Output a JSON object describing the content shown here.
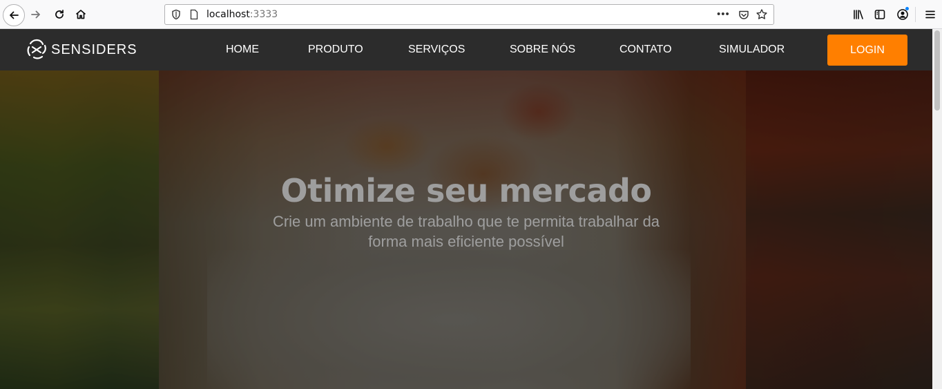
{
  "browser": {
    "url_host": "localhost",
    "url_port": ":3333",
    "more_label": "•••"
  },
  "site": {
    "logo_text": "SENSIDERS",
    "nav": [
      "HOME",
      "PRODUTO",
      "SERVIÇOS",
      "SOBRE NÓS",
      "CONTATO",
      "SIMULADOR"
    ],
    "login_label": "LOGIN",
    "accent_color": "#ff7f00",
    "navbar_color": "#2c2c2c"
  },
  "hero": {
    "title": "Otimize seu mercado",
    "subtitle_line1": "Crie um ambiente de trabalho que te permita trabalhar da",
    "subtitle_line2": "forma mais eficiente possível"
  }
}
